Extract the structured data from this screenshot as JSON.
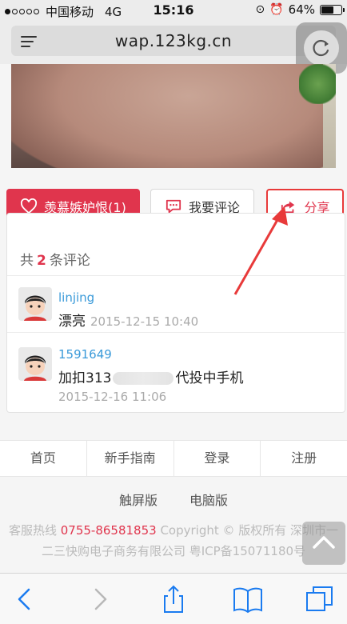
{
  "status_bar": {
    "carrier": "中国移动",
    "network": "4G",
    "time": "15:16",
    "battery": "64%",
    "battery_level": 0.64
  },
  "browser": {
    "url": "wap.123kg.cn"
  },
  "actions": {
    "like_label": "羡慕嫉妒恨(1)",
    "comment_label": "我要评论",
    "share_label": "分享"
  },
  "comments": {
    "header_prefix": "共",
    "count": "2",
    "header_suffix": "条评论",
    "items": [
      {
        "user": "linjing",
        "text": "漂亮",
        "time": "2015-12-15 10:40"
      },
      {
        "user": "1591649",
        "text_before": "加扣313",
        "text_after": "代投中手机",
        "time": "2015-12-16 11:06"
      }
    ]
  },
  "footer": {
    "nav": [
      "首页",
      "新手指南",
      "登录",
      "注册"
    ],
    "versions": [
      "触屏版",
      "电脑版"
    ],
    "hotline_label": "客服热线",
    "hotline": "0755-86581853",
    "copyright_line1": "Copyright © 版权所有 深圳市一",
    "copyright_line2": "二三快购电子商务有限公司 粤ICP备15071180号"
  },
  "colors": {
    "accent": "#e0354d",
    "link": "#3a9ad9",
    "annotation": "#e83a3a"
  }
}
